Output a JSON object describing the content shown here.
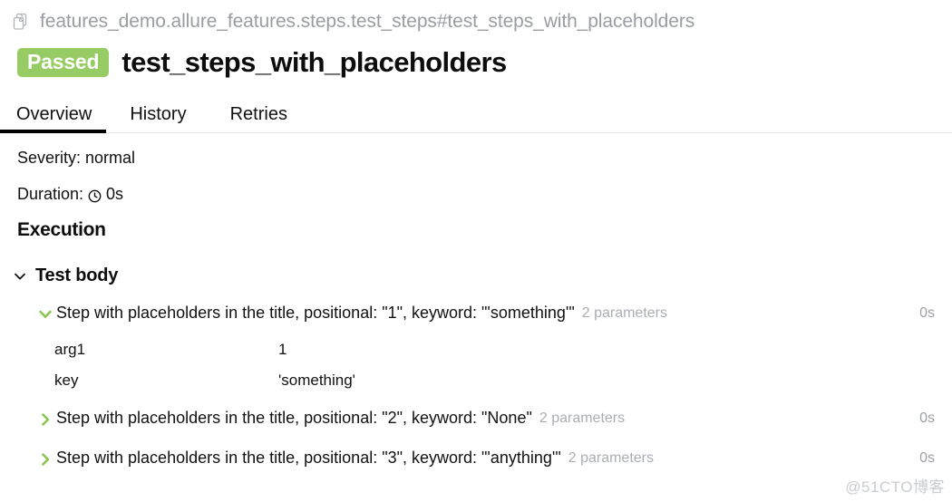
{
  "breadcrumb": {
    "icon": "copy-pages-icon",
    "text": "features_demo.allure_features.steps.test_steps#test_steps_with_placeholders"
  },
  "header": {
    "status": "Passed",
    "status_color": "#97cc64",
    "title": "test_steps_with_placeholders"
  },
  "tabs": [
    {
      "label": "Overview",
      "active": true
    },
    {
      "label": "History",
      "active": false
    },
    {
      "label": "Retries",
      "active": false
    }
  ],
  "meta": {
    "severity_label": "Severity:",
    "severity_value": "normal",
    "duration_label": "Duration:",
    "duration_icon": "clock-icon",
    "duration_value": "0s"
  },
  "execution": {
    "heading": "Execution",
    "group": {
      "label": "Test body",
      "expanded": true,
      "chevron": "chevron-down-icon"
    },
    "steps": [
      {
        "chevron": "chevron-down-icon",
        "chevron_color": "#8ac652",
        "expanded": true,
        "title": "Step with placeholders in the title, positional: \"1\", keyword: \"'something'\"",
        "parameters_label": "2 parameters",
        "time": "0s",
        "parameters": [
          {
            "name": "arg1",
            "value": "1"
          },
          {
            "name": "key",
            "value": "'something'"
          }
        ]
      },
      {
        "chevron": "chevron-right-icon",
        "chevron_color": "#8ac652",
        "expanded": false,
        "title": "Step with placeholders in the title, positional: \"2\", keyword: \"None\"",
        "parameters_label": "2 parameters",
        "time": "0s",
        "parameters": []
      },
      {
        "chevron": "chevron-right-icon",
        "chevron_color": "#8ac652",
        "expanded": false,
        "title": "Step with placeholders in the title, positional: \"3\", keyword: \"'anything'\"",
        "parameters_label": "2 parameters",
        "time": "0s",
        "parameters": []
      }
    ]
  },
  "watermark": "@51CTO博客"
}
